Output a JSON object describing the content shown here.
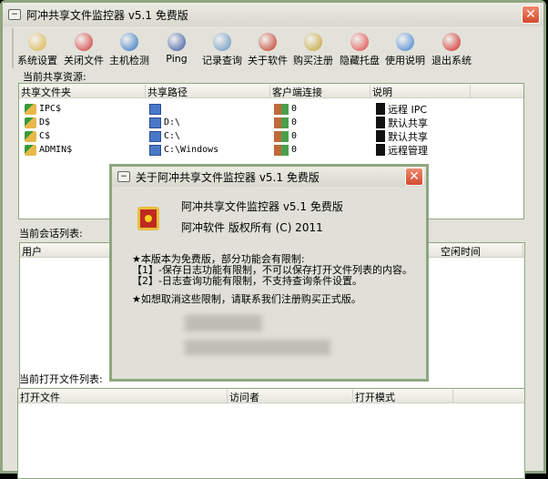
{
  "window": {
    "title": "阿冲共享文件监控器 v5.1 免费版",
    "close_icon": "close-icon"
  },
  "toolbar": [
    {
      "label": "系统设置",
      "icon": "settings-icon",
      "color": "#d8b040"
    },
    {
      "label": "关闭文件",
      "icon": "close-file-icon",
      "color": "#d03030"
    },
    {
      "label": "主机检测",
      "icon": "globe-icon",
      "color": "#2a70c0"
    },
    {
      "label": "Ping",
      "icon": "network-icon",
      "color": "#3050a0"
    },
    {
      "label": "记录查询",
      "icon": "search-log-icon",
      "color": "#6090c0"
    },
    {
      "label": "关于软件",
      "icon": "about-icon",
      "color": "#c03020"
    },
    {
      "label": "购买注册",
      "icon": "key-icon",
      "color": "#c0a030"
    },
    {
      "label": "隐藏托盘",
      "icon": "tray-icon",
      "color": "#e04040"
    },
    {
      "label": "使用说明",
      "icon": "help-icon",
      "color": "#3a80d0"
    },
    {
      "label": "退出系统",
      "icon": "exit-icon",
      "color": "#d02020"
    }
  ],
  "shares": {
    "label": "当前共享资源:",
    "columns": [
      "共享文件夹",
      "共享路径",
      "客户端连接",
      "说明"
    ],
    "rows": [
      {
        "name": "IPC$",
        "path": "",
        "clients": "0",
        "desc": "远程 IPC"
      },
      {
        "name": "D$",
        "path": "D:\\",
        "clients": "0",
        "desc": "默认共享"
      },
      {
        "name": "C$",
        "path": "C:\\",
        "clients": "0",
        "desc": "默认共享"
      },
      {
        "name": "ADMIN$",
        "path": "C:\\Windows",
        "clients": "0",
        "desc": "远程管理"
      }
    ]
  },
  "sessions": {
    "label": "当前会话列表:",
    "columns": [
      "用户",
      "空闲时间"
    ]
  },
  "open_files": {
    "label": "当前打开文件列表:",
    "columns": [
      "打开文件",
      "访问者",
      "打开模式"
    ]
  },
  "about_dialog": {
    "title": "关于阿冲共享文件监控器 v5.1 免费版",
    "product": "阿冲共享文件监控器 v5.1 免费版",
    "copyright": "阿冲软件 版权所有 (C) 2011",
    "notice_title": "★本版本为免费版，部分功能会有限制:",
    "notice_1": "【1】-保存日志功能有限制，不可以保存打开文件列表的内容。",
    "notice_2": "【2】-日志查询功能有限制，不支持查询条件设置。",
    "notice_3": "★如想取消这些限制，请联系我们注册购买正式版。"
  }
}
